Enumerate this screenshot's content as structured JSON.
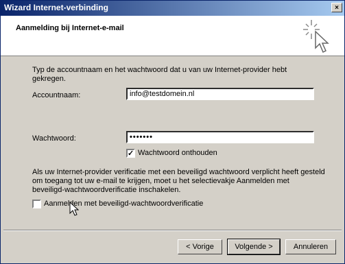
{
  "window": {
    "title": "Wizard Internet-verbinding",
    "close_glyph": "×"
  },
  "header": {
    "title": "Aanmelding bij Internet-e-mail"
  },
  "intro": {
    "line1": "Typ de accountnaam en het wachtwoord dat u van uw Internet-provider hebt",
    "line2": "gekregen."
  },
  "account": {
    "label": "Accountnaam:",
    "value": "info@testdomein.nl"
  },
  "password": {
    "label": "Wachtwoord:",
    "value": "•••••••"
  },
  "remember": {
    "label": "Wachtwoord onthouden",
    "checked": true,
    "check_glyph": "✓"
  },
  "spa_info": {
    "line1": "Als uw Internet-provider verificatie met een beveiligd wachtwoord verplicht heeft gesteld",
    "line2": "om toegang tot uw e-mail te krijgen, moet u het selectievakje Aanmelden met",
    "line3": "beveiligd-wachtwoordverificatie inschakelen."
  },
  "spa": {
    "label": "Aanmelden met beveiligd-wachtwoordverificatie",
    "checked": false
  },
  "buttons": {
    "back": "< Vorige",
    "next": "Volgende >",
    "cancel": "Annuleren"
  }
}
